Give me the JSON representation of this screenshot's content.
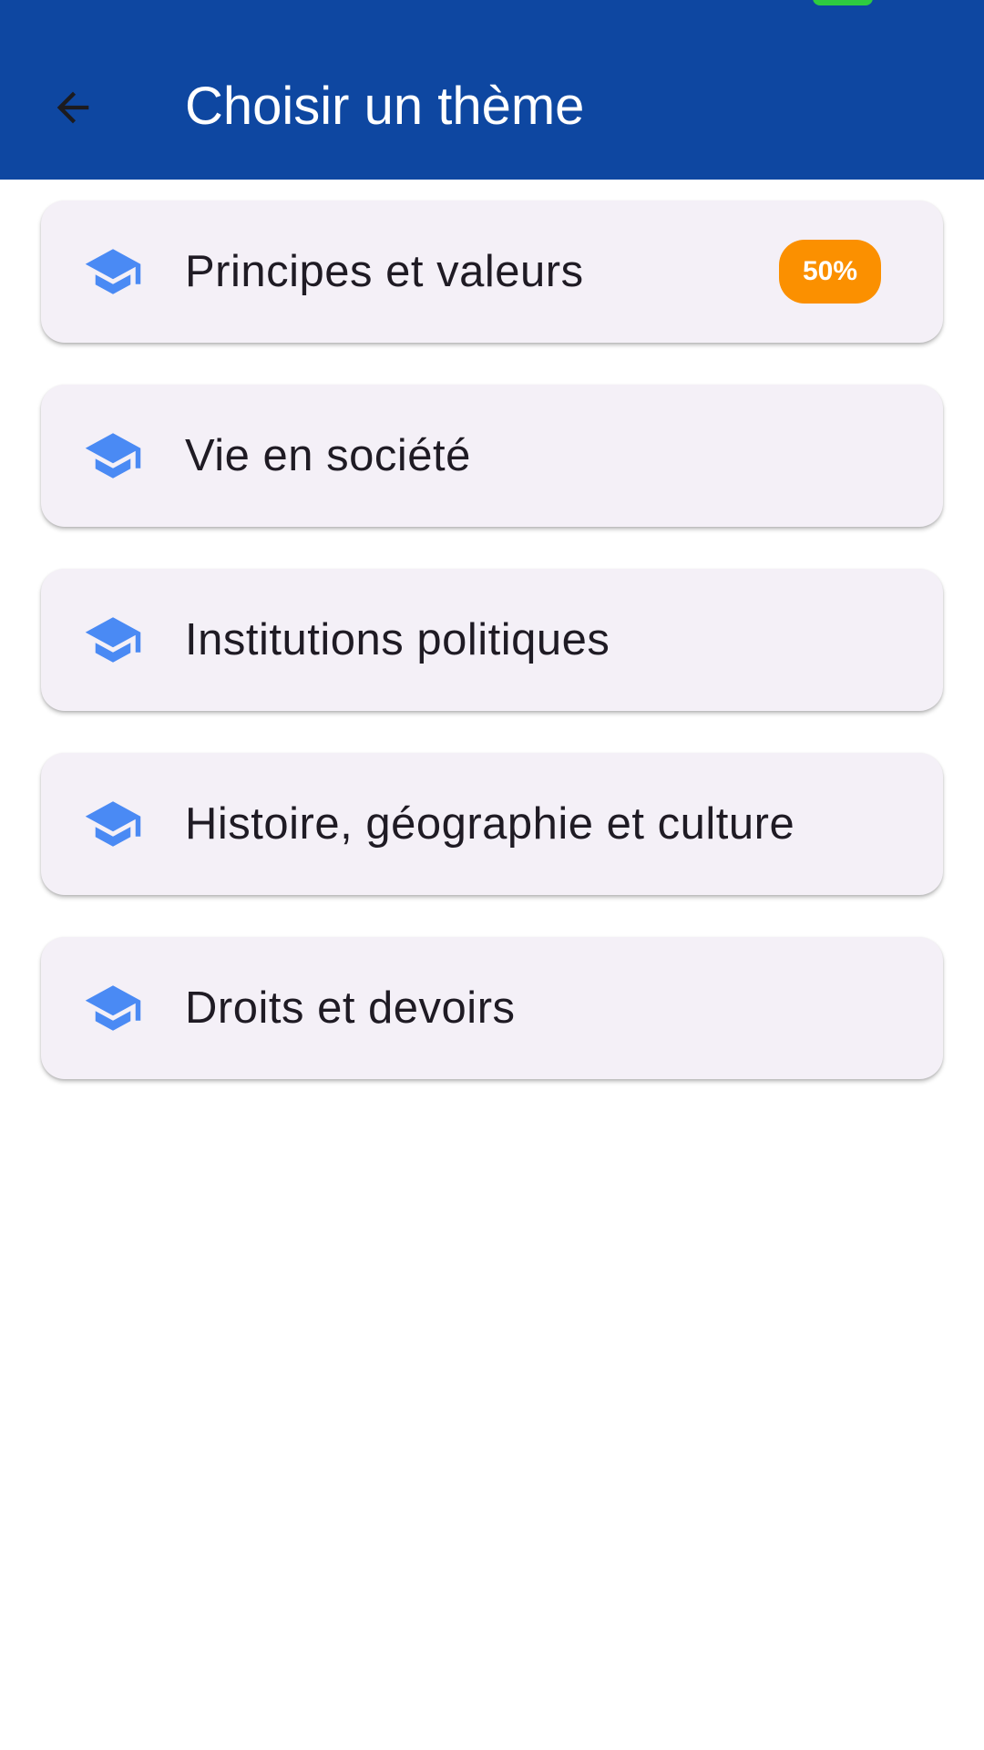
{
  "colors": {
    "app_bar": "#0e47a1",
    "icon_blue": "#4a8af4",
    "card_bg": "#f4f0f7",
    "badge_orange": "#fb9000"
  },
  "header": {
    "back_icon": "arrow-back-icon",
    "title": "Choisir un thème"
  },
  "themes": [
    {
      "label": "Principes et valeurs",
      "icon": "graduation-cap-icon",
      "badge": "50%",
      "progress_percent": 50
    },
    {
      "label": "Vie en société",
      "icon": "graduation-cap-icon"
    },
    {
      "label": "Institutions politiques",
      "icon": "graduation-cap-icon"
    },
    {
      "label": "Histoire, géographie et culture",
      "icon": "graduation-cap-icon"
    },
    {
      "label": "Droits et devoirs",
      "icon": "graduation-cap-icon"
    }
  ]
}
